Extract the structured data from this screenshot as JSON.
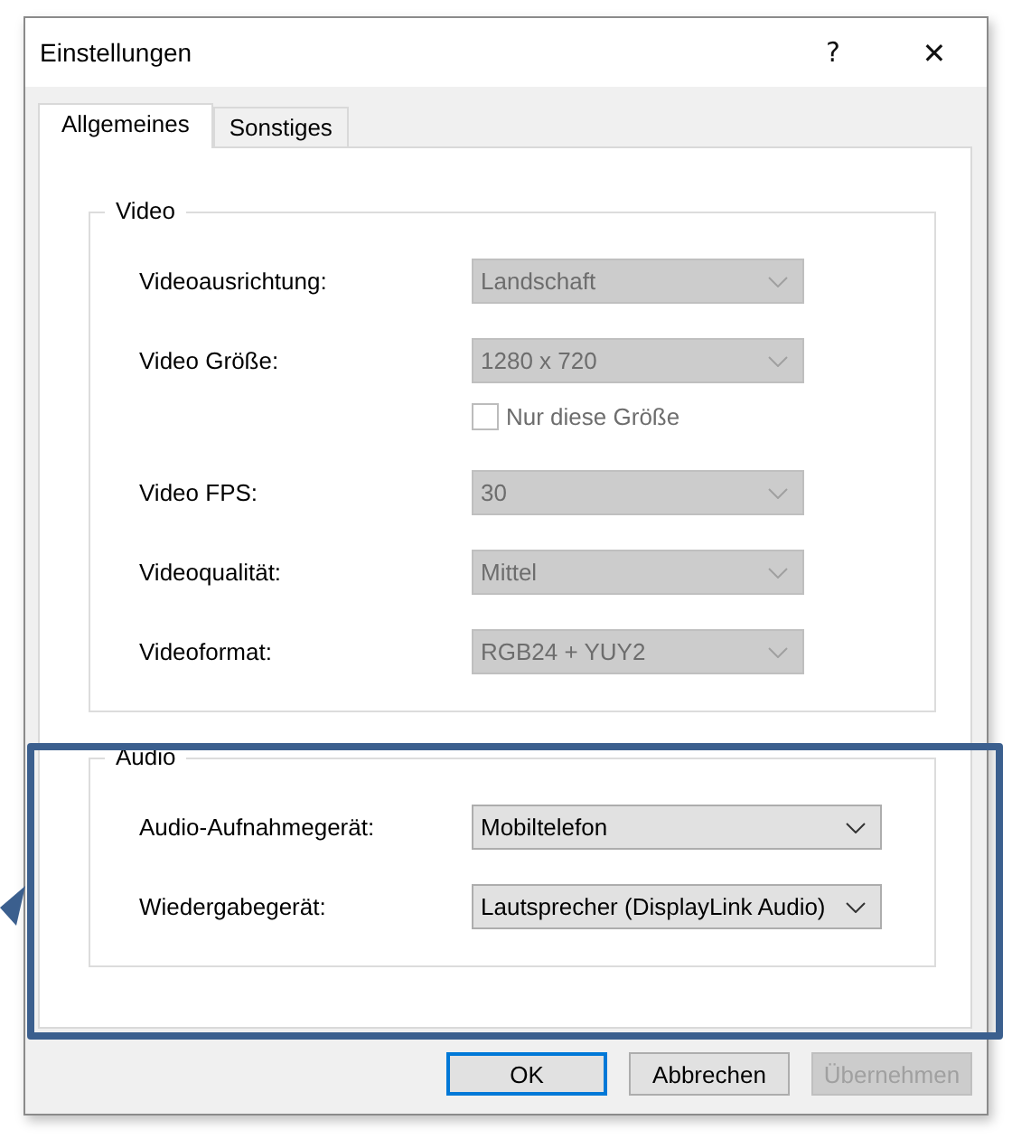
{
  "window": {
    "title": "Einstellungen",
    "help": "?",
    "close": "✕"
  },
  "tabs": [
    {
      "label": "Allgemeines",
      "selected": true
    },
    {
      "label": "Sonstiges",
      "selected": false
    }
  ],
  "groups": [
    {
      "title": "Video",
      "rows": [
        {
          "kind": "combo",
          "label": "Videoausrichtung:",
          "value": "Landschaft",
          "disabled": true
        },
        {
          "kind": "combo",
          "label": "Video Größe:",
          "value": "1280 x 720",
          "disabled": true
        },
        {
          "kind": "checkbox",
          "label": "Nur diese Größe",
          "checked": false,
          "disabled": true
        },
        {
          "kind": "combo",
          "label": "Video FPS:",
          "value": "30",
          "disabled": true
        },
        {
          "kind": "combo",
          "label": "Videoqualität:",
          "value": "Mittel",
          "disabled": true
        },
        {
          "kind": "combo",
          "label": "Videoformat:",
          "value": "RGB24 + YUY2",
          "disabled": true
        }
      ]
    },
    {
      "title": "Audio",
      "rows": [
        {
          "kind": "combo",
          "label": "Audio-Aufnahmegerät:",
          "value": "Mobiltelefon",
          "disabled": false
        },
        {
          "kind": "combo",
          "label": "Wiedergabegerät:",
          "value": "Lautsprecher (DisplayLink Audio)",
          "disabled": false
        }
      ]
    }
  ],
  "buttons": [
    {
      "label": "OK",
      "default": true,
      "disabled": false
    },
    {
      "label": "Abbrechen",
      "default": false,
      "disabled": false
    },
    {
      "label": "Übernehmen",
      "default": false,
      "disabled": true
    }
  ]
}
